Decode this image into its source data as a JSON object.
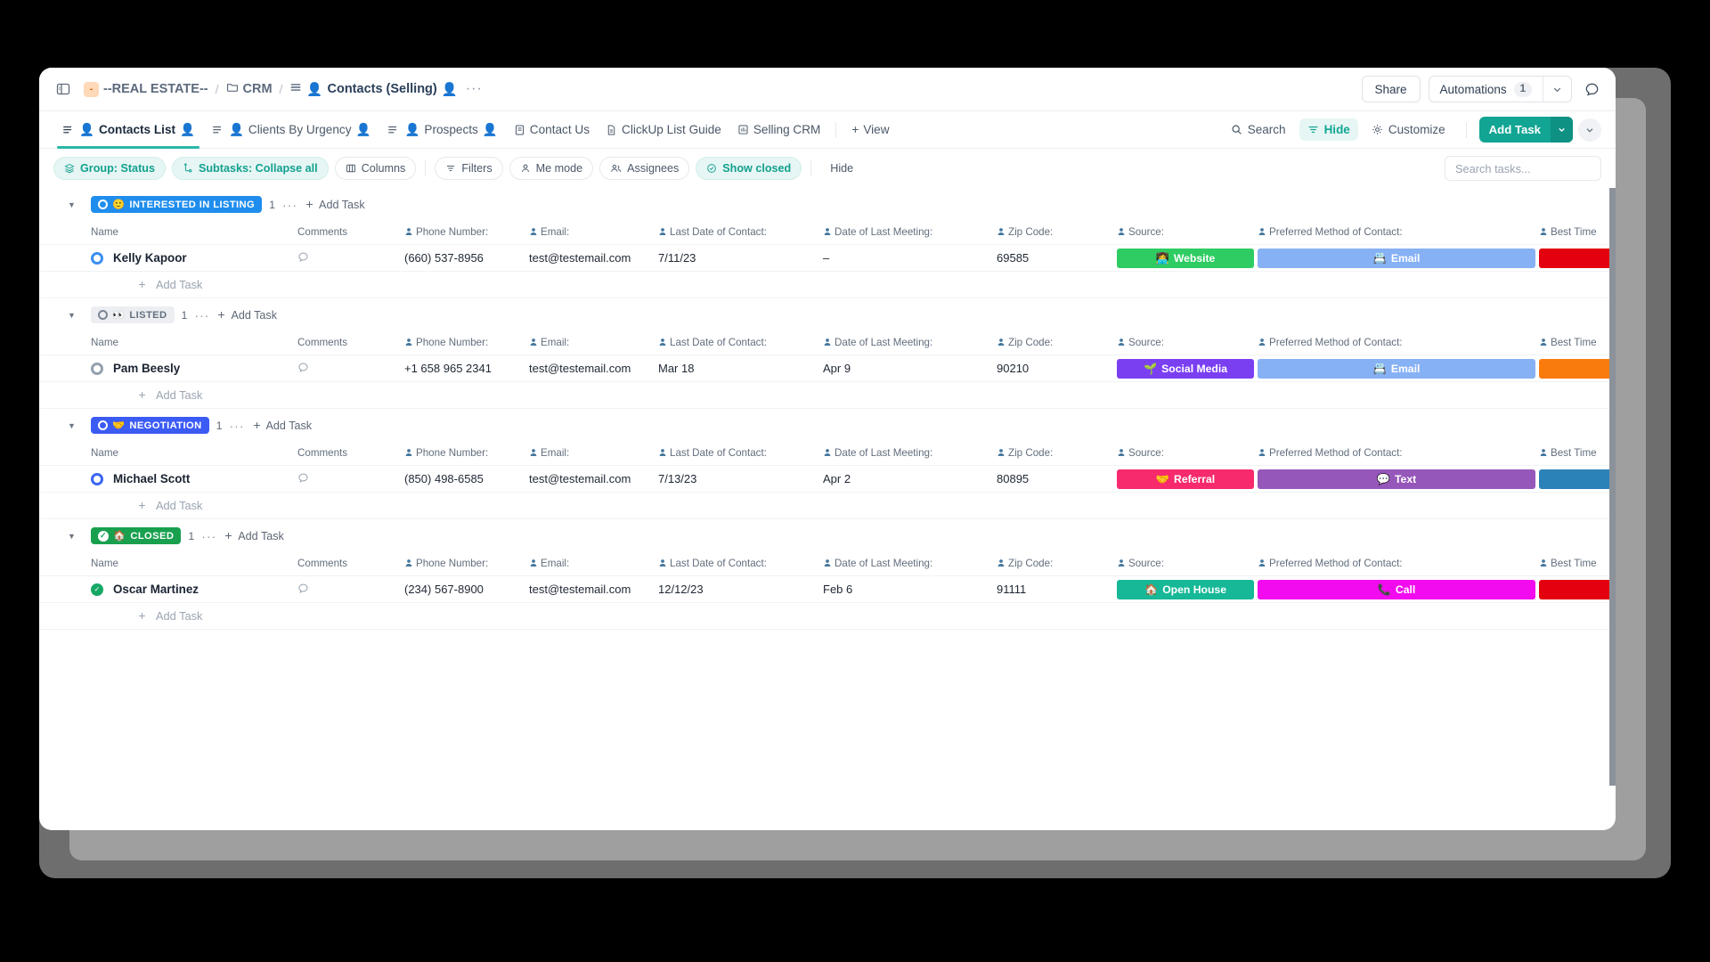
{
  "topbar": {
    "sidebar_toggle_icon": "panel-toggle-icon",
    "space_initial": "-",
    "breadcrumbs": [
      {
        "label": "--REAL ESTATE--",
        "icon": "space-square-icon"
      },
      {
        "label": "CRM",
        "icon": "folder-icon"
      },
      {
        "label": "Contacts (Selling)",
        "icon": "list-icon",
        "trailing_icon": "person-icon"
      }
    ],
    "more_dots": "···",
    "share_label": "Share",
    "automations_label": "Automations",
    "automations_count": "1",
    "caret_icon": "chevron-down-icon",
    "search_icon": "search-chat-icon"
  },
  "tabs": [
    {
      "label": "Contacts List",
      "icon": "list-person-icon",
      "active": true
    },
    {
      "label": "Clients By Urgency",
      "icon": "list-person-icon",
      "active": false
    },
    {
      "label": "Prospects",
      "icon": "list-person-icon",
      "active": false
    },
    {
      "label": "Contact Us",
      "icon": "form-icon",
      "active": false
    },
    {
      "label": "ClickUp List Guide",
      "icon": "doc-icon",
      "active": false
    },
    {
      "label": "Selling CRM",
      "icon": "dashboard-icon",
      "active": false
    }
  ],
  "add_view_label": "View",
  "viewbar": {
    "search_label": "Search",
    "hide_label": "Hide",
    "customize_label": "Customize",
    "add_task_label": "Add Task"
  },
  "chips": [
    {
      "label": "Group: Status",
      "icon": "layers-icon",
      "style": "teal"
    },
    {
      "label": "Subtasks: Collapse all",
      "icon": "subtask-icon",
      "style": "teal"
    },
    {
      "label": "Columns",
      "icon": "columns-icon",
      "style": "outline"
    },
    {
      "label": "Filters",
      "icon": "filter-icon",
      "style": "outline"
    },
    {
      "label": "Me mode",
      "icon": "person-icon",
      "style": "outline"
    },
    {
      "label": "Assignees",
      "icon": "people-icon",
      "style": "outline"
    },
    {
      "label": "Show closed",
      "icon": "check-circle-icon",
      "style": "teal"
    },
    {
      "label": "Hide",
      "icon": "",
      "style": "plain"
    }
  ],
  "search": {
    "placeholder": "Search tasks..."
  },
  "columns": [
    {
      "key": "name",
      "label": "Name",
      "icon": ""
    },
    {
      "key": "comments",
      "label": "Comments",
      "icon": ""
    },
    {
      "key": "phone",
      "label": "Phone Number:",
      "icon": "person-icon"
    },
    {
      "key": "email",
      "label": "Email:",
      "icon": "person-icon"
    },
    {
      "key": "last_contact",
      "label": "Last Date of Contact:",
      "icon": "person-icon"
    },
    {
      "key": "last_meeting",
      "label": "Date of Last Meeting:",
      "icon": "person-icon"
    },
    {
      "key": "zip",
      "label": "Zip Code:",
      "icon": "person-icon"
    },
    {
      "key": "source",
      "label": "Source:",
      "icon": "person-icon"
    },
    {
      "key": "preferred",
      "label": "Preferred Method of Contact:",
      "icon": "person-icon"
    },
    {
      "key": "best_time",
      "label": "Best Time",
      "icon": "person-icon"
    }
  ],
  "add_task_row_label": "Add Task",
  "group_add_task_label": "Add Task",
  "groups": [
    {
      "status": "INTERESTED IN LISTING",
      "status_emoji": "🙂",
      "status_color": "#1f8ded",
      "status_style": "color",
      "count": "1",
      "tasks": [
        {
          "name": "Kelly Kapoor",
          "dot": "ring-blue",
          "phone": "(660) 537-8956",
          "email": "test@testemail.com",
          "last_contact": "7/11/23",
          "last_meeting": "–",
          "zip": "69585",
          "source": {
            "label": "Website",
            "emoji": "👩‍💻",
            "color": "#2ecc62"
          },
          "preferred": {
            "label": "Email",
            "emoji": "📇",
            "color": "#87b1f5"
          },
          "best_time": {
            "label": "",
            "emoji": "",
            "color": "#e3000f"
          }
        }
      ]
    },
    {
      "status": "LISTED",
      "status_emoji": "👀",
      "status_color": "#eceef1",
      "status_style": "grey",
      "count": "1",
      "tasks": [
        {
          "name": "Pam Beesly",
          "dot": "ring-grey",
          "phone": "+1 658 965 2341",
          "email": "test@testemail.com",
          "last_contact": "Mar 18",
          "last_meeting": "Apr 9",
          "zip": "90210",
          "source": {
            "label": "Social Media",
            "emoji": "🌱",
            "color": "#7b3ff2"
          },
          "preferred": {
            "label": "Email",
            "emoji": "📇",
            "color": "#87b1f5"
          },
          "best_time": {
            "label": "",
            "emoji": "",
            "color": "#f97b0c"
          }
        }
      ]
    },
    {
      "status": "NEGOTIATION",
      "status_emoji": "🤝",
      "status_color": "#3b5bf5",
      "status_style": "color",
      "count": "1",
      "tasks": [
        {
          "name": "Michael Scott",
          "dot": "ring-indigo",
          "phone": "(850) 498-6585",
          "email": "test@testemail.com",
          "last_contact": "7/13/23",
          "last_meeting": "Apr 2",
          "zip": "80895",
          "source": {
            "label": "Referral",
            "emoji": "🤝",
            "color": "#f72a6d"
          },
          "preferred": {
            "label": "Text",
            "emoji": "💬",
            "color": "#9657ba"
          },
          "best_time": {
            "label": "",
            "emoji": "",
            "color": "#2b82b8"
          }
        }
      ]
    },
    {
      "status": "CLOSED",
      "status_emoji": "🏠",
      "status_color": "#18a04f",
      "status_style": "done",
      "count": "1",
      "tasks": [
        {
          "name": "Oscar Martinez",
          "dot": "done",
          "phone": "(234) 567-8900",
          "email": "test@testemail.com",
          "last_contact": "12/12/23",
          "last_meeting": "Feb 6",
          "zip": "91111",
          "source": {
            "label": "Open House",
            "emoji": "🏠",
            "color": "#16b897"
          },
          "preferred": {
            "label": "Call",
            "emoji": "📞",
            "color": "#f20bef"
          },
          "best_time": {
            "label": "",
            "emoji": "",
            "color": "#e3000f"
          }
        }
      ]
    }
  ]
}
